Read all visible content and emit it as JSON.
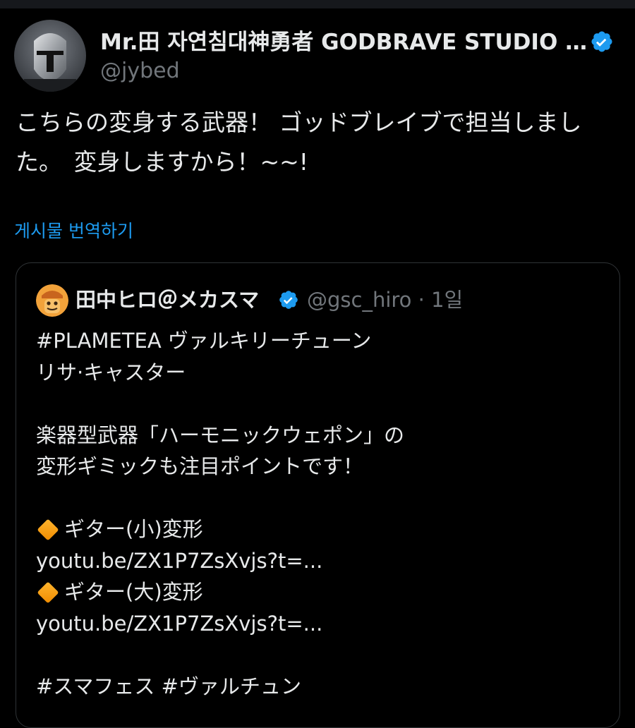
{
  "post": {
    "author_name": "Mr.田 자연침대神勇者 GODBRAVE STUDIO B...",
    "author_handle": "@jybed",
    "avatar_icon": "helmet-avatar-icon",
    "verified_icon": "verified-badge-icon",
    "text_line1": "こちらの変身する武器！ ゴッドブレイブで担当しまし",
    "text_line2": "た。　変身しますから！~~!",
    "translate_label": "게시물 번역하기"
  },
  "quote": {
    "author_name": "田中ヒロ＠メカスマ",
    "author_handle": "@gsc_hiro · 1일",
    "lines": [
      "#PLAMETEA ヴァルキリーチューン",
      "リサ·キャスター",
      "",
      "楽器型武器「ハーモニックウェポン」の",
      "変形ギミックも注目ポイントです！",
      "",
      "ギター(小)変形",
      "youtu.be/ZX1P7ZsXvjs?t=...",
      "ギター(大)変形",
      "youtu.be/ZX1P7ZsXvjs?t=...",
      "",
      "#スマフェス #ヴァルチュン"
    ],
    "bullet_icon": "orange-diamond-icon"
  },
  "colors": {
    "background": "#000000",
    "text": "#e7e9ea",
    "muted": "#71767b",
    "link": "#1d9bf0",
    "border": "#2f3336",
    "verified": "#1d9bf0"
  }
}
